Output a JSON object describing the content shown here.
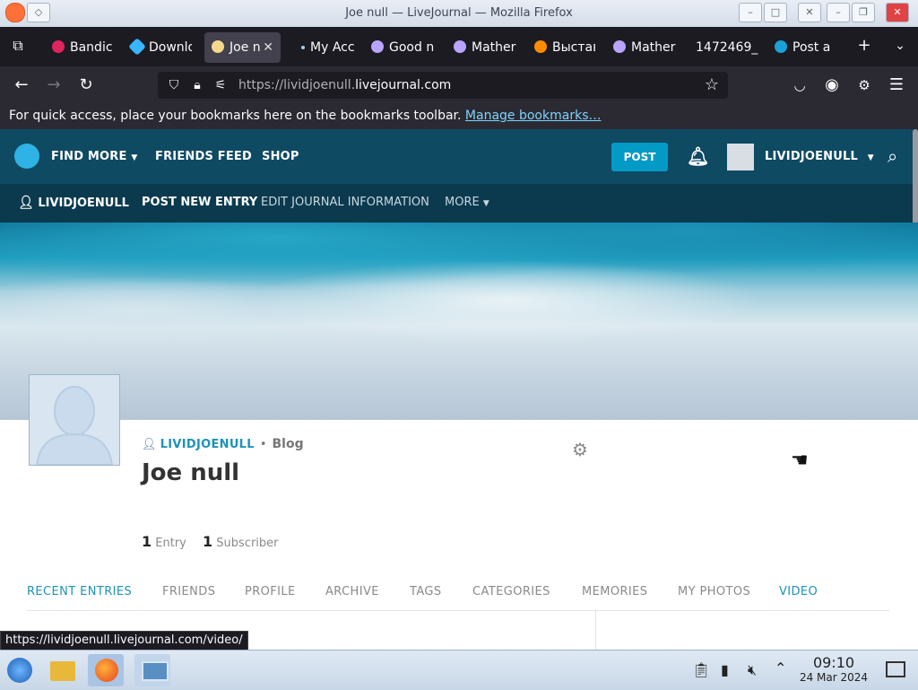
{
  "window": {
    "title": "Joe null — LiveJournal — Mozilla Firefox",
    "controls": [
      "–",
      "□",
      "✕"
    ]
  },
  "tabs": [
    {
      "label": "Bandic",
      "icon": "record-icon",
      "color": "#e0245e"
    },
    {
      "label": "Downlo",
      "icon": "download-icon",
      "color": "#38b6ff"
    },
    {
      "label": "Joe n",
      "icon": "user-icon",
      "color": "#f5d98b",
      "active": true
    },
    {
      "label": "My Acc",
      "icon": "dot-icon",
      "color": "#9ad0f5"
    },
    {
      "label": "Good n",
      "icon": "user-icon",
      "color": "#b9a4ff"
    },
    {
      "label": "Mather",
      "icon": "user-icon",
      "color": "#b9a4ff"
    },
    {
      "label": "Выстав",
      "icon": "fox-icon",
      "color": "#ff8c00"
    },
    {
      "label": "Mather",
      "icon": "user-icon",
      "color": "#b9a4ff"
    },
    {
      "label": "1472469_",
      "icon": "blank-icon",
      "color": "#1c1b22"
    },
    {
      "label": "Post a",
      "icon": "lj-icon",
      "color": "#1aa1d6"
    }
  ],
  "nav": {
    "url_prefix": "https://lividjoenull.",
    "url_domain": "livejournal.com"
  },
  "bookmarks": {
    "message": "For quick access, place your bookmarks here on the bookmarks toolbar.",
    "link": "Manage bookmarks…"
  },
  "lj_header": {
    "find_more": "FIND MORE",
    "friends_feed": "FRIENDS FEED",
    "shop": "SHOP",
    "post": "POST",
    "username": "LIVIDJOENULL"
  },
  "lj_subnav": {
    "username": "LIVIDJOENULL",
    "post_new_entry": "POST NEW ENTRY",
    "edit_journal": "EDIT JOURNAL INFORMATION",
    "more": "MORE"
  },
  "profile": {
    "username": "LIVIDJOENULL",
    "kind": "Blog",
    "full_name": "Joe null",
    "description": "",
    "entries_count": "1",
    "entries_label": "Entry",
    "subscribers_count": "1",
    "subscribers_label": "Subscriber"
  },
  "journal_tabs": [
    "RECENT ENTRIES",
    "FRIENDS",
    "PROFILE",
    "ARCHIVE",
    "TAGS",
    "CATEGORIES",
    "MEMORIES",
    "MY PHOTOS",
    "VIDEO"
  ],
  "status_url": "https://lividjoenull.livejournal.com/video/",
  "taskbar": {
    "time": "09:10",
    "date": "24 Mar 2024"
  },
  "colors": {
    "lj_header": "#0f4a63",
    "lj_accent": "#1d93b7",
    "post_button": "#049ac6"
  }
}
